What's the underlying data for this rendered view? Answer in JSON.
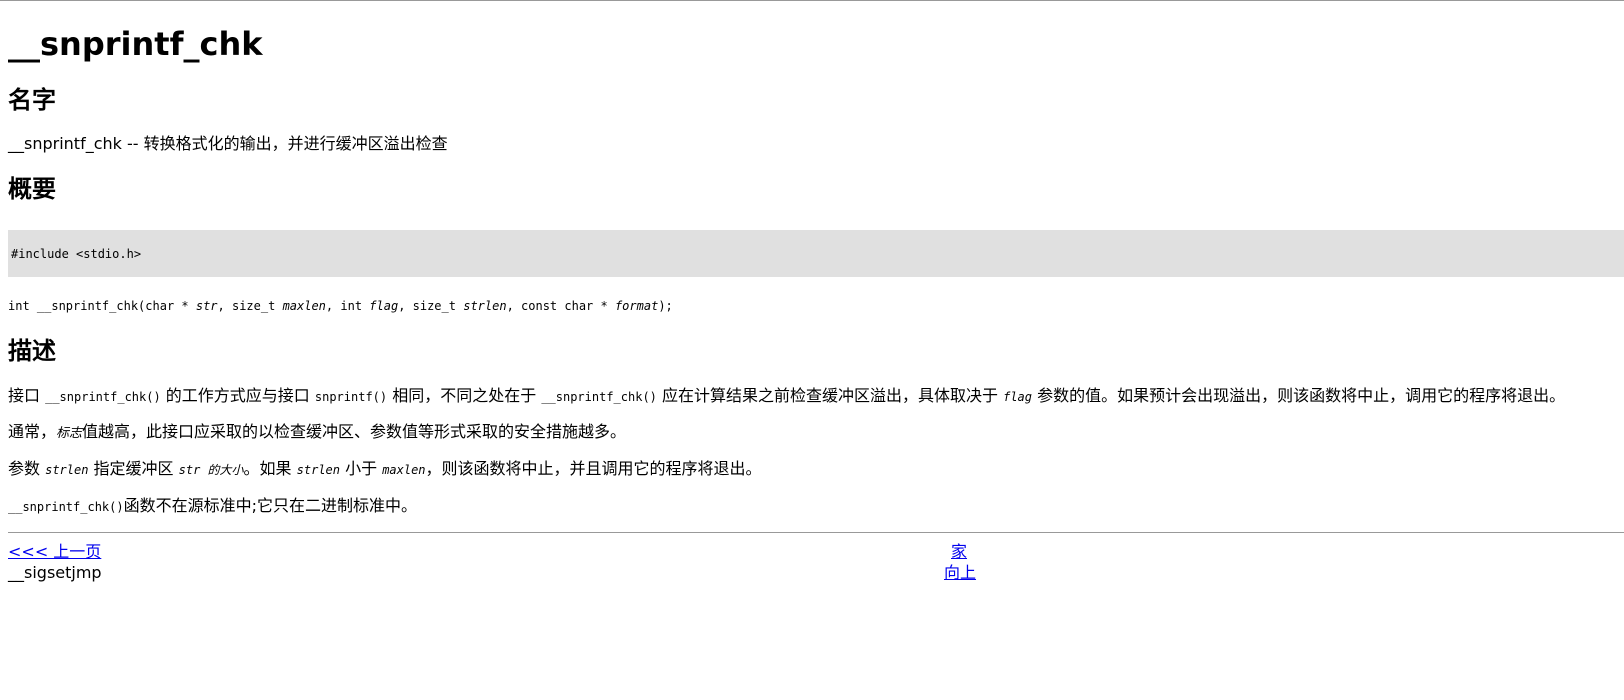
{
  "page": {
    "title": "__snprintf_chk"
  },
  "name_section": {
    "heading": "名字",
    "text": "__snprintf_chk -- 转换格式化的输出，并进行缓冲区溢出检查"
  },
  "synopsis_section": {
    "heading": "概要",
    "include": "#include <stdio.h>",
    "prototype": {
      "p1": "int __snprintf_chk(char * ",
      "a1": "str",
      "p2": ", size_t ",
      "a2": "maxlen",
      "p3": ", int ",
      "a3": "flag",
      "p4": ", size_t ",
      "a4": "strlen",
      "p5": ", const char * ",
      "a5": "format",
      "p6": ");"
    }
  },
  "description_section": {
    "heading": "描述",
    "para1": {
      "t1": "接口 ",
      "c1": "__snprintf_chk()",
      "t2": " 的工作方式应与接口 ",
      "c2": "snprintf()",
      "t3": " 相同，不同之处在于 ",
      "c3": "__snprintf_chk()",
      "t4": " 应在计算结果之前检查缓冲区溢出，具体取决于 ",
      "c4": "flag",
      "t5": " 参数的值。如果预计会出现溢出，则该函数将中止，调用它的程序将退出。"
    },
    "para2": {
      "t1": "通常，",
      "i1": "标志",
      "t2": "值越高，此接口应采取的以检查缓冲区、参数值等形式采取的安全措施越多。"
    },
    "para3": {
      "t1": "参数 ",
      "c1": "strlen",
      "t2": " 指定缓冲区 ",
      "c2": "str 的大小",
      "t3": "。如果 ",
      "c3": "strlen",
      "t4": " 小于 ",
      "c4": "maxlen",
      "t5": "，则该函数将中止，并且调用它的程序将退出。"
    },
    "para4": {
      "c1": "__snprintf_chk()",
      "t1": "函数不在源标准中;它只在二进制标准中。"
    }
  },
  "footer_nav": {
    "prev_link": "<<< 上一页",
    "home_link": "家",
    "up_link": "向上",
    "prev_title": "__sigsetjmp"
  }
}
